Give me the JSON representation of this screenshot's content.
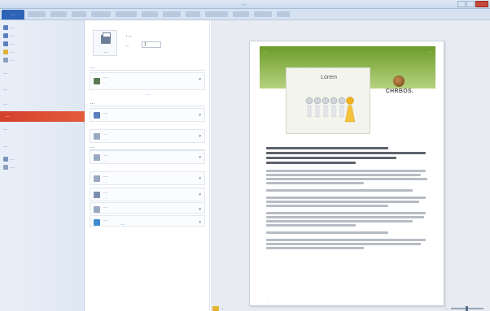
{
  "titlebar": {
    "title": "…"
  },
  "ribbon": {
    "file_tab": "…",
    "tab_count": 12
  },
  "nav": {
    "items_top": [
      {
        "label": "…",
        "icon": "save-icon"
      },
      {
        "label": "…",
        "icon": "save-as-icon"
      },
      {
        "label": "…",
        "icon": "save-pdf-icon"
      },
      {
        "label": "…",
        "icon": "open-folder-icon"
      },
      {
        "label": "…",
        "icon": "close-file-icon"
      }
    ],
    "section_info": "…",
    "section_recent": "…",
    "section_new": "…",
    "active": "…",
    "section_share": "…",
    "section_help": "…",
    "items_bottom": [
      {
        "label": "…",
        "icon": "options-icon"
      },
      {
        "label": "…",
        "icon": "exit-icon"
      }
    ]
  },
  "print": {
    "button_label": "…",
    "title": "…",
    "copies_label": "…",
    "copies_value": "1",
    "printer_section": "…",
    "printer_name": "…",
    "printer_status": "…",
    "printer_properties_link": "…",
    "settings_section": "…",
    "options": [
      {
        "l1": "…",
        "l2": "…",
        "icon_color": "#5b7fbf"
      },
      {
        "l1": "…",
        "l2": "…",
        "icon_color": "#9aa9c2"
      },
      {
        "l1": "…",
        "l2": "…",
        "icon_color": "#9aa9c2"
      },
      {
        "l1": "…",
        "l2": "…",
        "icon_color": "#9aa9c2"
      },
      {
        "l1": "…",
        "l2": "…",
        "icon_color": "#7d8fae"
      },
      {
        "l1": "…",
        "l2": "",
        "icon_color": "#9aa9c2"
      },
      {
        "l1": "…",
        "l2": "",
        "icon_color": "#3f8bd3"
      }
    ],
    "pages_label": "…",
    "page_setup_link": "…"
  },
  "preview": {
    "band_title": "…",
    "band_page": "…",
    "card_title": "Lorem",
    "card_sub": "…",
    "logo_text": "CHRBOS.",
    "footer_left": "…",
    "footer_right": "…",
    "page_nav": "…",
    "zoom_label": "…"
  }
}
